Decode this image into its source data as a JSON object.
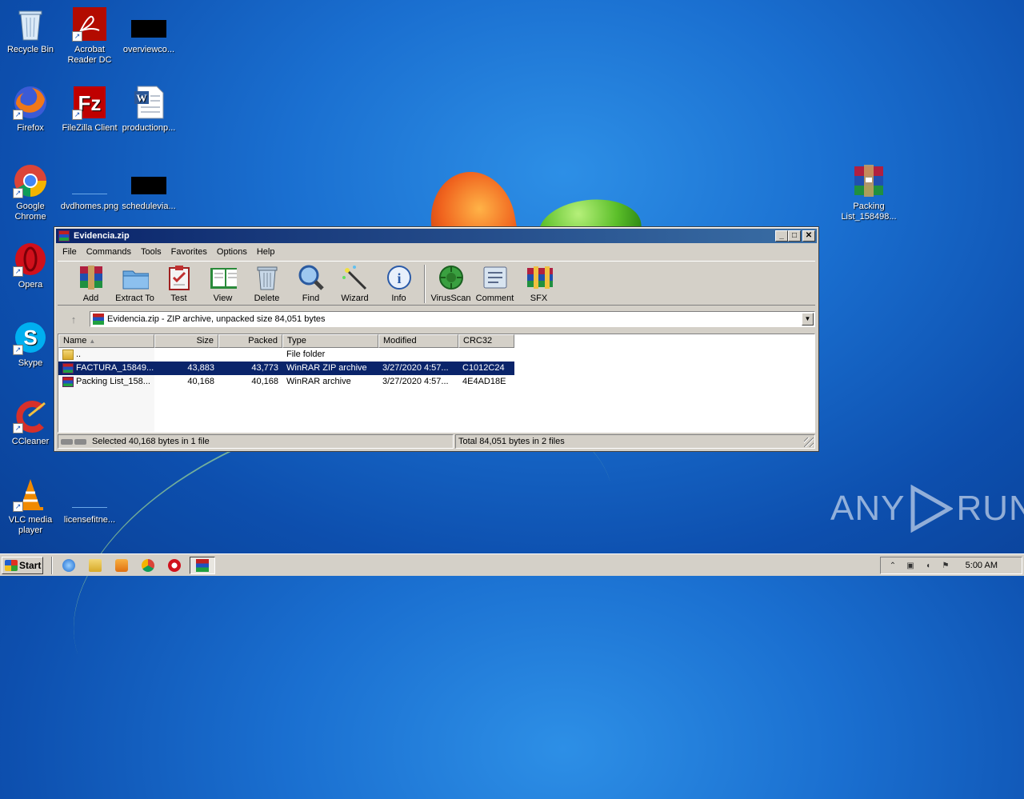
{
  "desktop": {
    "icons": [
      {
        "label": "Recycle Bin"
      },
      {
        "label": "Acrobat Reader DC"
      },
      {
        "label": "overviewco..."
      },
      {
        "label": "Firefox"
      },
      {
        "label": "FileZilla Client"
      },
      {
        "label": "productionp..."
      },
      {
        "label": "Google Chrome"
      },
      {
        "label": "dvdhomes.png"
      },
      {
        "label": "schedulevia..."
      },
      {
        "label": "Opera"
      },
      {
        "label": "Skype"
      },
      {
        "label": "CCleaner"
      },
      {
        "label": "VLC media player"
      },
      {
        "label": "licensefitne..."
      },
      {
        "label": "Packing List_158498..."
      }
    ]
  },
  "window": {
    "title": "Evidencia.zip",
    "controls": {
      "minimize": "_",
      "maximize": "□",
      "close": "✕"
    },
    "menu": [
      "File",
      "Commands",
      "Tools",
      "Favorites",
      "Options",
      "Help"
    ],
    "toolbar": [
      {
        "label": "Add",
        "icon": "add-archive-icon"
      },
      {
        "label": "Extract To",
        "icon": "extract-folder-icon"
      },
      {
        "label": "Test",
        "icon": "test-clipboard-icon"
      },
      {
        "label": "View",
        "icon": "view-book-icon"
      },
      {
        "label": "Delete",
        "icon": "trash-icon"
      },
      {
        "label": "Find",
        "icon": "magnifier-icon"
      },
      {
        "label": "Wizard",
        "icon": "wand-icon"
      },
      {
        "label": "Info",
        "icon": "info-icon"
      },
      {
        "label": "VirusScan",
        "icon": "virus-scan-icon"
      },
      {
        "label": "Comment",
        "icon": "comment-icon"
      },
      {
        "label": "SFX",
        "icon": "sfx-books-icon"
      }
    ],
    "address": "Evidencia.zip - ZIP archive, unpacked size 84,051 bytes",
    "columns": {
      "name": "Name",
      "size": "Size",
      "packed": "Packed",
      "type": "Type",
      "modified": "Modified",
      "crc": "CRC32"
    },
    "rows": [
      {
        "name": "..",
        "size": "",
        "packed": "",
        "type": "File folder",
        "modified": "",
        "crc": "",
        "icon": "folder"
      },
      {
        "name": "FACTURA_15849...",
        "size": "43,883",
        "packed": "43,773",
        "type": "WinRAR ZIP archive",
        "modified": "3/27/2020 4:57...",
        "crc": "C1012C24",
        "icon": "rar",
        "selected": true
      },
      {
        "name": "Packing List_158...",
        "size": "40,168",
        "packed": "40,168",
        "type": "WinRAR archive",
        "modified": "3/27/2020 4:57...",
        "crc": "4E4AD18E",
        "icon": "rar"
      }
    ],
    "status_left": "Selected 40,168 bytes in 1 file",
    "status_right": "Total 84,051 bytes in 2 files"
  },
  "taskbar": {
    "start_label": "Start",
    "clock": "5:00 AM"
  },
  "watermark": {
    "left": "ANY",
    "right": "RUN"
  }
}
